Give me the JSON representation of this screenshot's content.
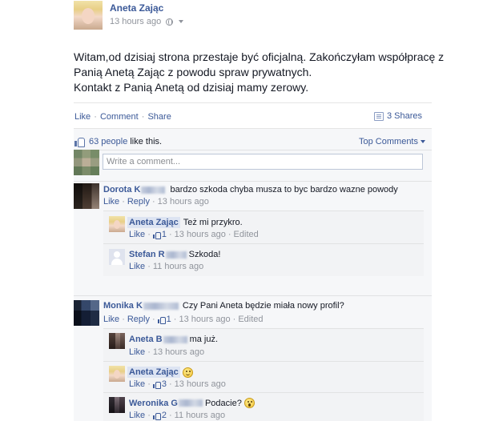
{
  "post": {
    "author": "Aneta Zając",
    "time": "13 hours ago",
    "text_lines": [
      "Witam,od dzisiaj strona przestaje być oficjalną. Zakończyłam współpracę z",
      "Panią Anetą Zając z powodu spraw prywatnych.",
      "Kontakt z Panią Anetą od dzisiaj mamy zerowy."
    ]
  },
  "actions": {
    "like": "Like",
    "comment": "Comment",
    "share": "Share",
    "shares": "3 Shares",
    "sep": "·"
  },
  "likes": {
    "count": "63 people",
    "suffix": "like this.",
    "top_comments": "Top Comments"
  },
  "composer": {
    "placeholder": "Write a comment..."
  },
  "comments": [
    {
      "name": "Dorota K",
      "text": "bardzo szkoda chyba musza to byc bardzo wazne powody",
      "like": "Like",
      "reply": "Reply",
      "time": "13 hours ago",
      "replies": [
        {
          "name": "Aneta Zając",
          "text": "Też mi przykro.",
          "like": "Like",
          "likes": "1",
          "time": "13 hours ago",
          "edited": "Edited"
        },
        {
          "name": "Stefan R",
          "text": "Szkoda!",
          "like": "Like",
          "time": "11 hours ago"
        }
      ]
    },
    {
      "name": "Monika K",
      "text": "Czy Pani Aneta będzie miała nowy profil?",
      "like": "Like",
      "reply": "Reply",
      "likes": "1",
      "time": "13 hours ago",
      "edited": "Edited",
      "replies": [
        {
          "name": "Aneta B",
          "text": "ma już.",
          "like": "Like",
          "time": "13 hours ago"
        },
        {
          "name": "Aneta Zając",
          "text": "",
          "like": "Like",
          "likes": "3",
          "time": "13 hours ago"
        },
        {
          "name": "Weronika G",
          "text": "Podacie?",
          "like": "Like",
          "likes": "2",
          "time": "11 hours ago"
        }
      ]
    }
  ],
  "colors": {
    "link": "#3b5998",
    "muted": "#90949c",
    "ufi_bg": "#f6f7f9",
    "highlight": "#dde4f2"
  },
  "icons": [
    "globe-icon",
    "chevron-down-icon",
    "share-icon",
    "thumbs-up-icon",
    "smile-emoji-icon",
    "shocked-emoji-icon"
  ]
}
